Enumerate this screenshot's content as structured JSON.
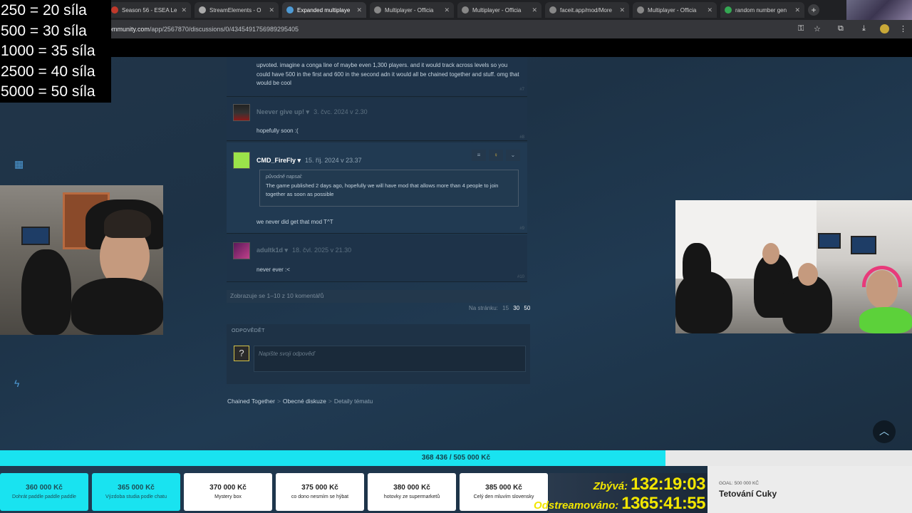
{
  "browser": {
    "tabs": [
      {
        "label": "Season 56 - ESEA Le",
        "active": false
      },
      {
        "label": "StreamElements - O",
        "active": false
      },
      {
        "label": "Expanded multiplaye",
        "active": true
      },
      {
        "label": "Multiplayer - Officia",
        "active": false
      },
      {
        "label": "Multiplayer - Officia",
        "active": false
      },
      {
        "label": "faceit.app/mod/More",
        "active": false
      },
      {
        "label": "Multiplayer - Officia",
        "active": false
      },
      {
        "label": "random number gen",
        "active": false
      }
    ],
    "new_tab_label": "+",
    "url_host": "amcommunity.com",
    "url_path": "/app/2567870/discussions/0/4345491756989295405"
  },
  "overlay_goals": [
    "250 = 20 síla",
    "500 = 30 síla",
    "1000 = 35 síla",
    "2500 = 40 síla",
    "5000 = 50 síla"
  ],
  "comments": [
    {
      "author": "",
      "date": "",
      "text": "upvoted. imagine a conga line of maybe even 1,300 players. and it would track across levels so you could have 500 in the first and 600 in the second adn it would all be chained together and stuff. omg that would be cool",
      "number": "#7"
    },
    {
      "author": "Neever give up!",
      "date": "3. čvc. 2024 v 2.30",
      "text": "hopefully soon :(",
      "number": "#8"
    },
    {
      "author": "CMD_FireFly",
      "date": "15. říj. 2024 v 23.37",
      "quote_header": "původně napsal:",
      "quote_text": "The game published 2 days ago, hopefully we will have mod that allows more than 4 people to join together as soon as possible",
      "text": "we never did get that mod T^T",
      "number": "#9"
    },
    {
      "author": "adultk1d",
      "date": "18. čvl. 2025 v 21.30",
      "text": "never ever :<",
      "number": "#10"
    }
  ],
  "pager": {
    "showing": "Zobrazuje se 1–10 z 10 komentářů",
    "per_page_label": "Na stránku:",
    "options": [
      "15",
      "30",
      "50"
    ],
    "selected": "30"
  },
  "reply": {
    "label": "ODPOVĚDĚT",
    "placeholder": "Napište svoji odpověď",
    "avatar_glyph": "?"
  },
  "breadcrumb": {
    "game": "Chained Together",
    "section": "Obecné diskuze",
    "current": "Detaily tématu"
  },
  "donation": {
    "progress_text": "368 436 / 505 000 Kč",
    "progress_fraction": 0.7296
  },
  "milestones": [
    {
      "amount": "360 000 Kč",
      "desc": "Dohrát paddle paddle paddle",
      "done": true
    },
    {
      "amount": "365 000 Kč",
      "desc": "Výzdoba studia podle chatu",
      "done": true
    },
    {
      "amount": "370 000 Kč",
      "desc": "Mystery box",
      "done": false
    },
    {
      "amount": "375 000 Kč",
      "desc": "co dono nesmím se hýbat",
      "done": false
    },
    {
      "amount": "380 000 Kč",
      "desc": "hotovky ze supermarketů",
      "done": false
    },
    {
      "amount": "385 000 Kč",
      "desc": "Celý den mluvím slovensky",
      "done": false
    }
  ],
  "timers": {
    "remaining_label": "Zbývá:",
    "remaining_value": "132:19:03",
    "streamed_label": "Odstreamováno:",
    "streamed_value": "1365:41:55"
  },
  "goal_box": {
    "label": "GOAL: 500 000 KČ",
    "title": "Tetování Cuky"
  },
  "colors": {
    "steam_bg": "#1b2838",
    "progress_fill": "#19e3f0",
    "timer_text": "#f2e600"
  }
}
